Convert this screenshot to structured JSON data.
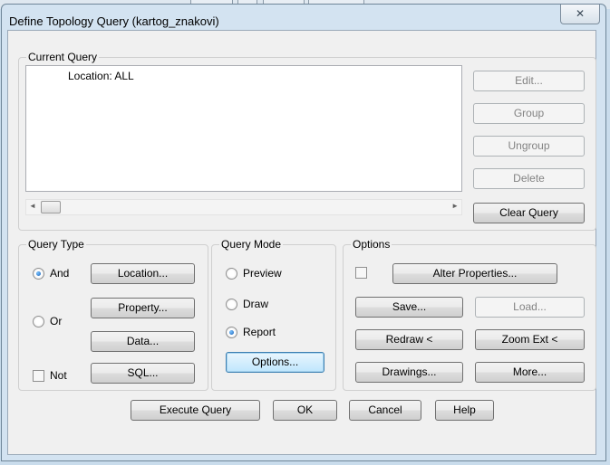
{
  "window": {
    "title": "Define Topology Query (kartog_znakovi)",
    "close_glyph": "✕"
  },
  "current_query": {
    "label": "Current Query",
    "items": [
      "Location: ALL"
    ],
    "buttons": {
      "edit": "Edit...",
      "group": "Group",
      "ungroup": "Ungroup",
      "delete": "Delete",
      "clear": "Clear Query"
    },
    "scroll": {
      "left": "◄",
      "right": "►"
    }
  },
  "query_type": {
    "label": "Query Type",
    "and": "And",
    "or": "Or",
    "not": "Not",
    "selected": "And",
    "not_checked": false,
    "buttons": {
      "location": "Location...",
      "property": "Property...",
      "data": "Data...",
      "sql": "SQL..."
    }
  },
  "query_mode": {
    "label": "Query Mode",
    "preview": "Preview",
    "draw": "Draw",
    "report": "Report",
    "selected": "Report",
    "options_button": "Options..."
  },
  "options": {
    "label": "Options",
    "alter_checked": false,
    "buttons": {
      "alter": "Alter Properties...",
      "save": "Save...",
      "load": "Load...",
      "redraw": "Redraw <",
      "zoom": "Zoom Ext <",
      "drawings": "Drawings...",
      "more": "More..."
    }
  },
  "footer": {
    "execute": "Execute Query",
    "ok": "OK",
    "cancel": "Cancel",
    "help": "Help"
  }
}
